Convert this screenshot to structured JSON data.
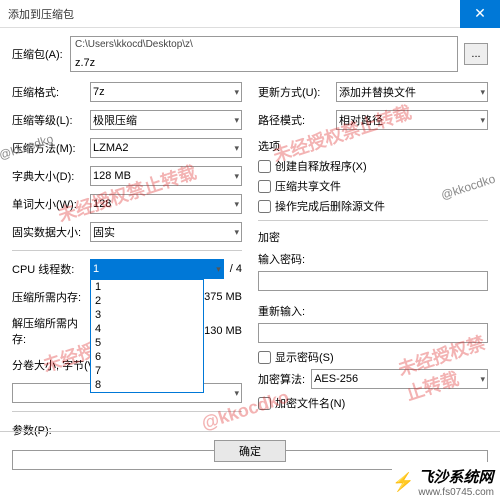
{
  "window": {
    "title": "添加到压缩包",
    "close_icon": "✕"
  },
  "archive": {
    "label": "压缩包(A):",
    "path_folder": "C:\\Users\\kkocd\\Desktop\\z\\",
    "filename": "z.7z",
    "browse": "..."
  },
  "left": {
    "format_lbl": "压缩格式:",
    "format_val": "7z",
    "level_lbl": "压缩等级(L):",
    "level_val": "极限压缩",
    "method_lbl": "压缩方法(M):",
    "method_val": "LZMA2",
    "dict_lbl": "字典大小(D):",
    "dict_val": "128 MB",
    "word_lbl": "单词大小(W):",
    "word_val": "128",
    "solid_lbl": "固实数据大小:",
    "solid_val": "固实",
    "cpu_lbl": "CPU 线程数:",
    "cpu_val": "1",
    "cpu_max": "/ 4",
    "cpu_options": [
      "1",
      "2",
      "3",
      "4",
      "5",
      "6",
      "7",
      "8"
    ],
    "mem_comp_lbl": "压缩所需内存:",
    "mem_comp_val": "1375 MB",
    "mem_decomp_lbl": "解压缩所需内存:",
    "mem_decomp_val": "130 MB",
    "split_lbl": "分卷大小, 字节(V):",
    "params_lbl": "参数(P):"
  },
  "right": {
    "update_lbl": "更新方式(U):",
    "update_val": "添加并替换文件",
    "pathmode_lbl": "路径模式:",
    "pathmode_val": "相对路径",
    "options_title": "选项",
    "opt_sfx": "创建自释放程序(X)",
    "opt_share": "压缩共享文件",
    "opt_delete": "操作完成后删除源文件",
    "encrypt_title": "加密",
    "pw_lbl": "输入密码:",
    "pw2_lbl": "重新输入:",
    "showpw": "显示密码(S)",
    "algo_lbl": "加密算法:",
    "algo_val": "AES-256",
    "encnames": "加密文件名(N)"
  },
  "buttons": {
    "ok": "确定"
  },
  "watermark": "未经授权禁止转载",
  "handle": "@kkocdko",
  "footer": {
    "brand": "飞沙系统网",
    "url": "www.fs0745.com"
  }
}
